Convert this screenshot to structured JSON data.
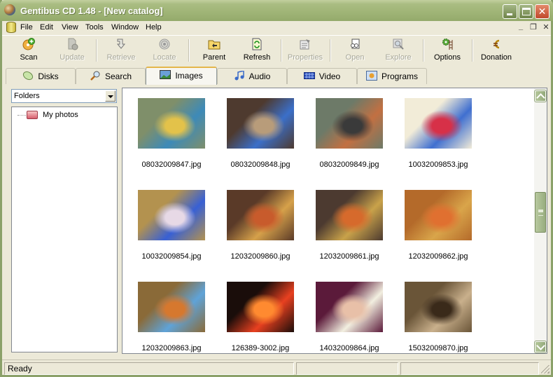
{
  "window": {
    "title": "Gentibus CD 1.48 - [New catalog]",
    "controls": {
      "minimize": "minimize",
      "maximize": "maximize",
      "close": "✕"
    }
  },
  "menubar": {
    "items": [
      "File",
      "Edit",
      "View",
      "Tools",
      "Window",
      "Help"
    ],
    "mdi": {
      "minimize": "_",
      "restore": "❐",
      "close": "✕"
    }
  },
  "toolbar": {
    "buttons": [
      {
        "label": "Scan",
        "icon": "scan-disc-icon",
        "enabled": true
      },
      {
        "label": "Update",
        "icon": "update-document-icon",
        "enabled": false
      },
      {
        "label": "Retrieve",
        "icon": "retrieve-arrow-icon",
        "enabled": false
      },
      {
        "label": "Locate",
        "icon": "locate-target-icon",
        "enabled": false
      },
      {
        "label": "Parent",
        "icon": "parent-folder-icon",
        "enabled": true
      },
      {
        "label": "Refresh",
        "icon": "refresh-icon",
        "enabled": true
      },
      {
        "label": "Properties",
        "icon": "properties-icon",
        "enabled": false
      },
      {
        "label": "Open",
        "icon": "open-icon",
        "enabled": false
      },
      {
        "label": "Explore",
        "icon": "explore-icon",
        "enabled": false
      },
      {
        "label": "Options",
        "icon": "options-gear-icon",
        "enabled": true
      },
      {
        "label": "Donation",
        "icon": "euro-icon",
        "enabled": true
      }
    ]
  },
  "tabs": [
    {
      "label": "Disks",
      "icon": "disks-icon",
      "active": false
    },
    {
      "label": "Search",
      "icon": "search-magnifier-icon",
      "active": false
    },
    {
      "label": "Images",
      "icon": "images-icon",
      "active": true
    },
    {
      "label": "Audio",
      "icon": "audio-notes-icon",
      "active": false
    },
    {
      "label": "Video",
      "icon": "video-film-icon",
      "active": false
    },
    {
      "label": "Programs",
      "icon": "programs-icon",
      "active": false
    }
  ],
  "left_pane": {
    "view_select": "Folders",
    "tree": [
      {
        "label": "My photos",
        "icon": "folder-icon"
      }
    ]
  },
  "images": [
    {
      "name": "08032009847.jpg",
      "colors": [
        "#7f8f6a",
        "#3d8ab8",
        "#e3c24a"
      ]
    },
    {
      "name": "08032009848.jpg",
      "colors": [
        "#4e3a2f",
        "#3b6fc9",
        "#b89c7a"
      ]
    },
    {
      "name": "08032009849.jpg",
      "colors": [
        "#6d7a68",
        "#c27042",
        "#3a3a3a"
      ]
    },
    {
      "name": "10032009853.jpg",
      "colors": [
        "#f2ecd8",
        "#3f6fd0",
        "#d73048"
      ]
    },
    {
      "name": "10032009854.jpg",
      "colors": [
        "#b3924f",
        "#3860d4",
        "#e7d9e6"
      ]
    },
    {
      "name": "12032009860.jpg",
      "colors": [
        "#5a3a28",
        "#d6a14a",
        "#c85b2c"
      ]
    },
    {
      "name": "12032009861.jpg",
      "colors": [
        "#4c3a30",
        "#c9a24a",
        "#d66a2c"
      ]
    },
    {
      "name": "12032009862.jpg",
      "colors": [
        "#b46a2a",
        "#d9a54a",
        "#e07030"
      ]
    },
    {
      "name": "12032009863.jpg",
      "colors": [
        "#8a6a38",
        "#5fa3d8",
        "#d6782e"
      ]
    },
    {
      "name": "126389-3002.jpg",
      "colors": [
        "#1a0d0a",
        "#e84020",
        "#ff8a30"
      ]
    },
    {
      "name": "14032009864.jpg",
      "colors": [
        "#5b1a3a",
        "#f2efe0",
        "#e8c0a8"
      ]
    },
    {
      "name": "15032009870.jpg",
      "colors": [
        "#6a5538",
        "#c9b08c",
        "#3a2a1a"
      ]
    }
  ],
  "statusbar": {
    "text": "Ready",
    "panel2": "",
    "panel3": ""
  }
}
